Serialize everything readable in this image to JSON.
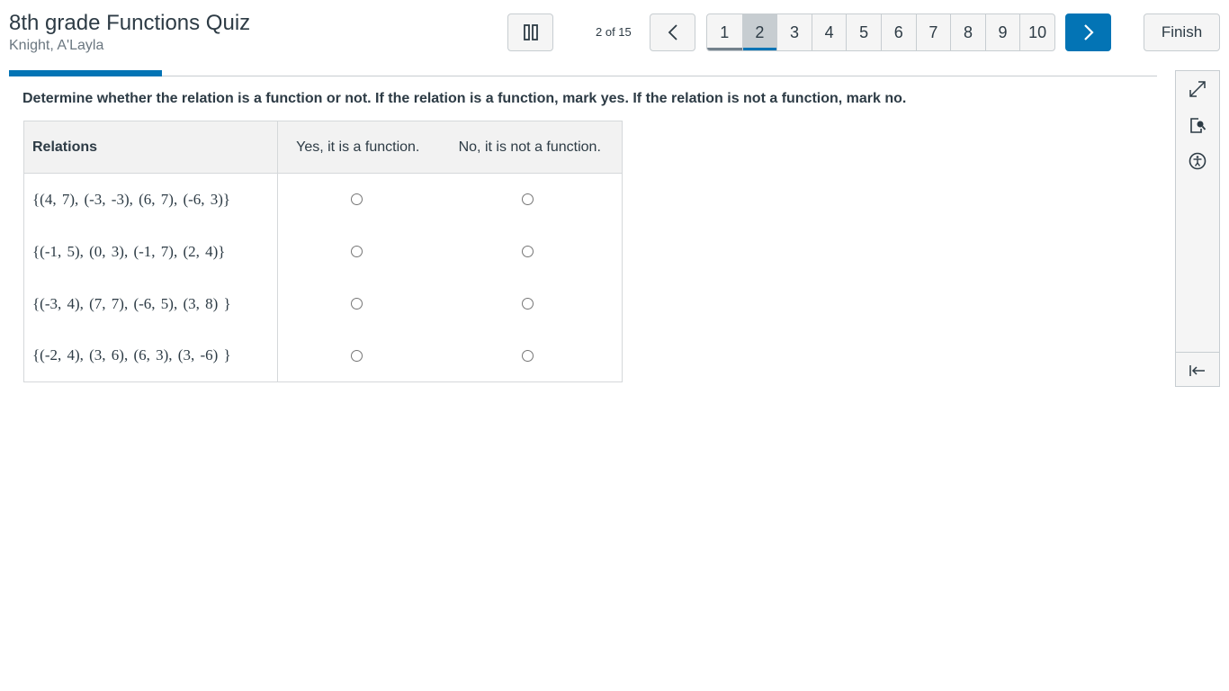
{
  "header": {
    "quiz_title": "8th grade Functions Quiz",
    "student_name": "Knight, A'Layla",
    "progress_text": "2 of 15",
    "finish_label": "Finish"
  },
  "pager": {
    "pages": [
      "1",
      "2",
      "3",
      "4",
      "5",
      "6",
      "7",
      "8",
      "9",
      "10"
    ],
    "current_page": 2,
    "total_questions": 15
  },
  "progress": {
    "fraction": 0.133
  },
  "question": {
    "prompt": "Determine whether the relation is a function or not. If the relation is a function, mark yes. If the relation is not a function, mark no.",
    "columns": [
      "Relations",
      "Yes, it is a function.",
      "No, it is not a function."
    ],
    "rows": [
      "{(4, 7), (-3, -3), (6, 7), (-6, 3)}",
      "{(-1, 5), (0, 3), (-1, 7), (2, 4)}",
      "{(-3, 4), (7, 7), (-6, 5), (3, 8) }",
      "{(-2, 4), (3, 6), (6, 3), (3, -6) }"
    ]
  },
  "icons": {
    "pause": "pause-icon",
    "previous": "chevron-left-icon",
    "next": "chevron-right-icon",
    "expand": "expand-icon",
    "document_search": "document-search-icon",
    "accessibility": "accessibility-icon",
    "collapse": "collapse-panel-icon"
  },
  "colors": {
    "accent": "#0374b5",
    "text": "#2d3b45",
    "border": "#c7cdd1"
  }
}
